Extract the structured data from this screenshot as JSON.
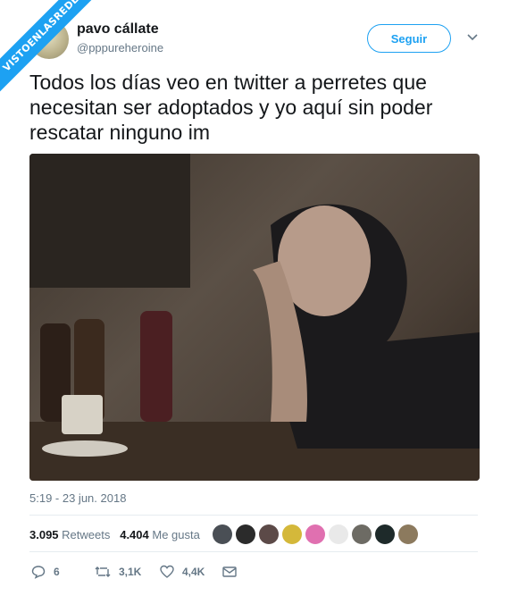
{
  "watermark": "VISTOENLASREDES",
  "author": {
    "display_name": "pavo cállate",
    "handle": "@pppureheroine"
  },
  "follow_button": {
    "label": "Seguir"
  },
  "tweet": {
    "text": "Todos los días veo en twitter a perretes que necesitan ser adoptados y yo aquí sin poder rescatar ninguno im",
    "timestamp": "5:19 - 23 jun. 2018"
  },
  "stats": {
    "retweets_count": "3.095",
    "retweets_label": "Retweets",
    "likes_count": "4.404",
    "likes_label": "Me gusta"
  },
  "liker_avatar_colors": [
    "#4a4f55",
    "#2b2b2b",
    "#5c4a48",
    "#d4b83a",
    "#e070b0",
    "#e9e9e9",
    "#6d6b64",
    "#1e2a2a",
    "#8c7a5e"
  ],
  "actions": {
    "reply_count": "6",
    "retweet_count": "3,1K",
    "like_count": "4,4K"
  },
  "colors": {
    "accent": "#1da1f2",
    "secondary_text": "#657786",
    "primary_text": "#14171a"
  },
  "icons": [
    "chevron-down-icon",
    "reply-icon",
    "retweet-icon",
    "heart-icon",
    "mail-icon"
  ]
}
